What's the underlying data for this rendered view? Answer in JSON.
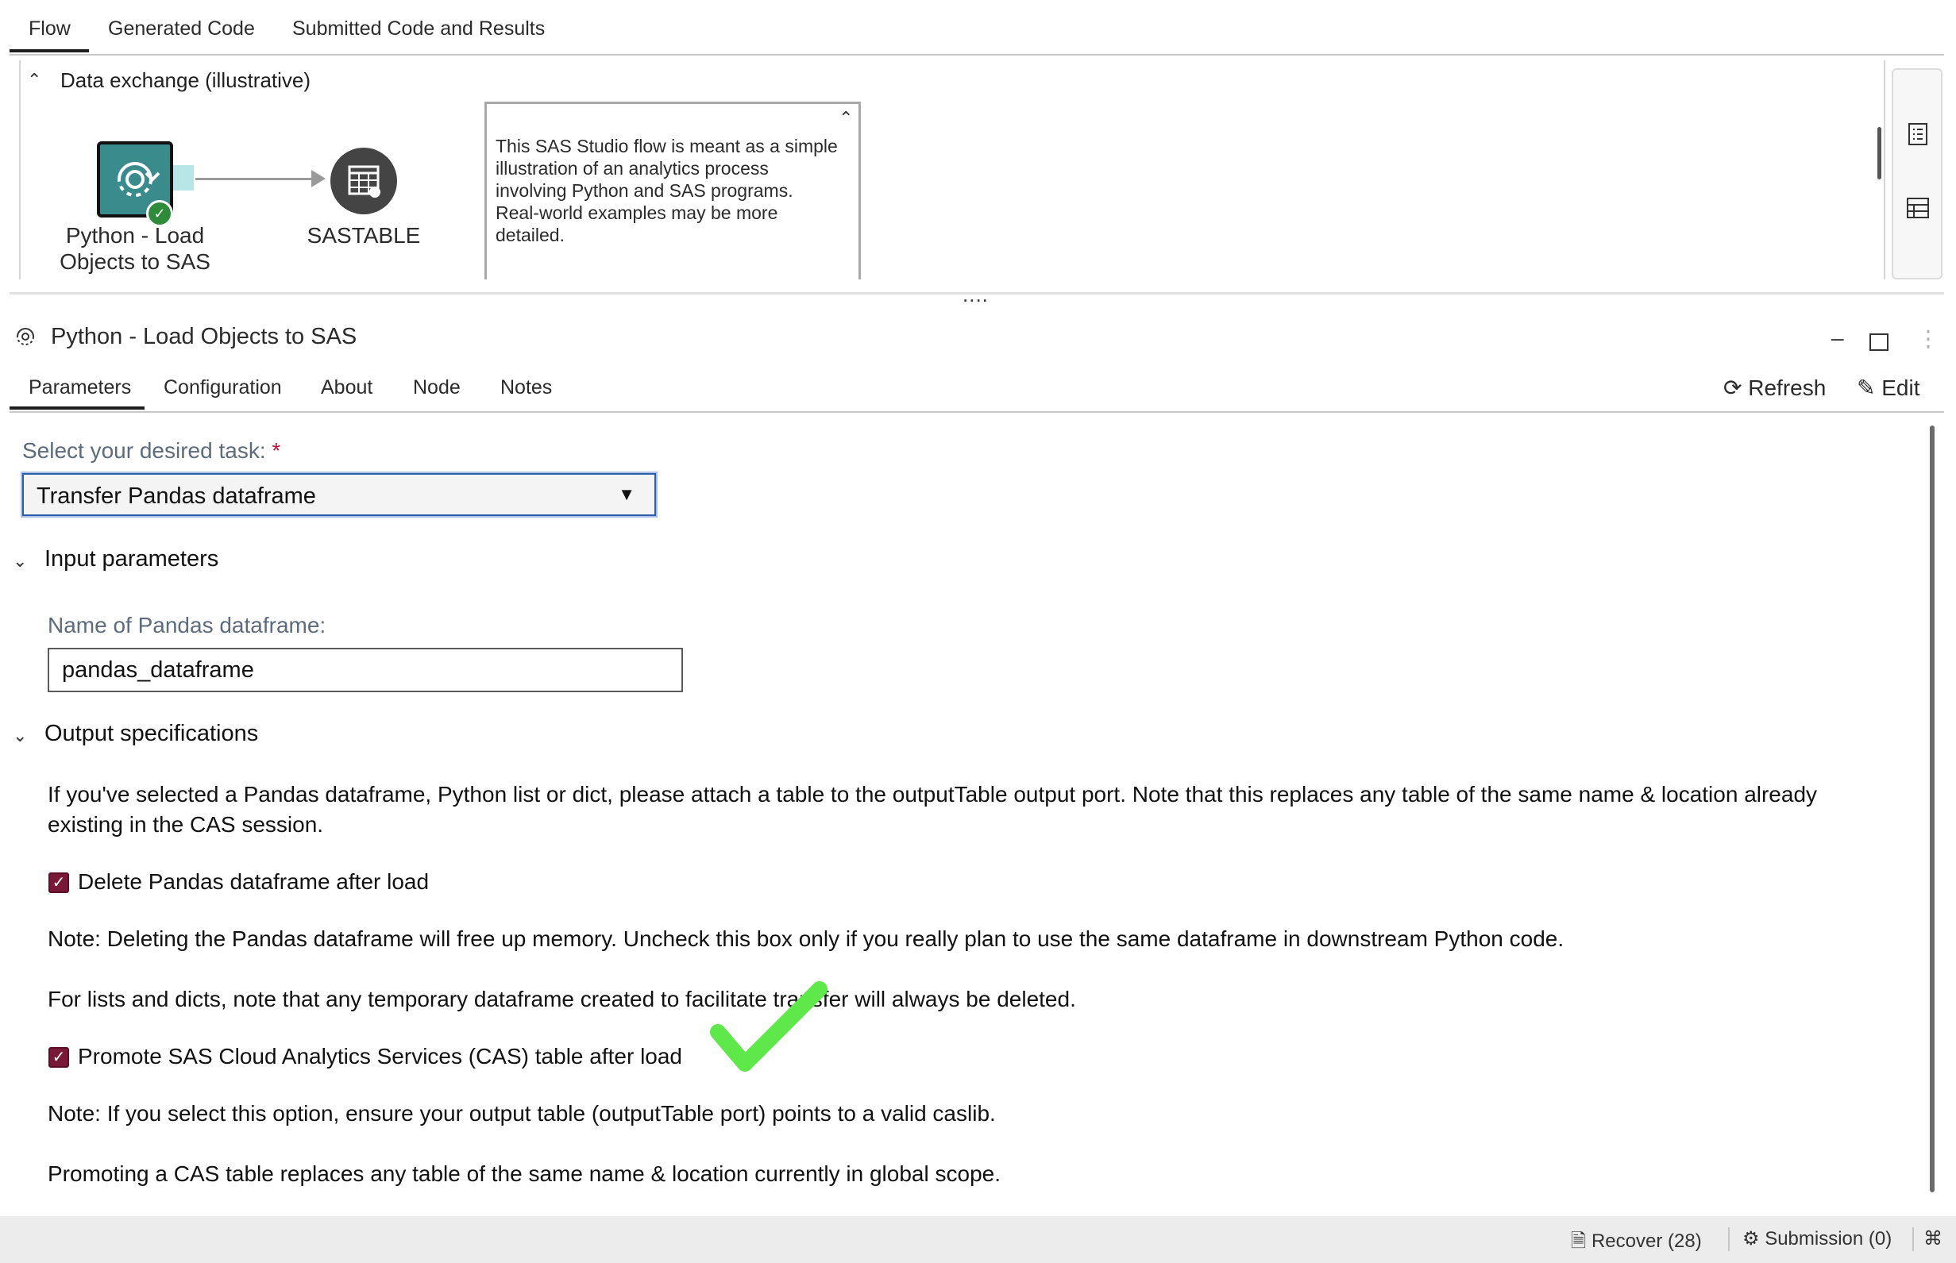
{
  "top_tabs": [
    {
      "label": "Flow",
      "active": true
    },
    {
      "label": "Generated Code",
      "active": false
    },
    {
      "label": "Submitted Code and Results",
      "active": false
    }
  ],
  "flow": {
    "title": "Data exchange (illustrative)",
    "nodes": [
      {
        "label_line1": "Python - Load",
        "label_line2": "Objects to SAS",
        "icon": "python-flow-node-icon",
        "status": "success"
      },
      {
        "label": "SASTABLE",
        "icon": "table-node-icon"
      }
    ],
    "note": {
      "lines": [
        "This SAS Studio flow is meant as a simple",
        "illustration of an analytics process",
        "involving Python and SAS programs.",
        "Real-world examples may be more",
        "detailed."
      ]
    },
    "splitter_handle": "...."
  },
  "node_panel": {
    "title": "Python - Load Objects to SAS",
    "tabs": [
      {
        "label": "Parameters",
        "active": true
      },
      {
        "label": "Configuration",
        "active": false
      },
      {
        "label": "About",
        "active": false
      },
      {
        "label": "Node",
        "active": false
      },
      {
        "label": "Notes",
        "active": false
      }
    ],
    "refresh_label": "Refresh",
    "edit_label": "Edit"
  },
  "form": {
    "task_label": "Select your desired task:",
    "required_mark": "*",
    "task_value": "Transfer Pandas dataframe",
    "input_section": "Input parameters",
    "df_name_label": "Name of Pandas dataframe:",
    "df_name_value": "pandas_dataframe",
    "output_section": "Output specifications",
    "output_desc_line1": "If you've selected a Pandas dataframe, Python list or dict, please attach a table to the outputTable output port.  Note that this replaces any table of the same name & location already",
    "output_desc_line2": "existing in the CAS session.",
    "delete_checkbox_label": "Delete Pandas dataframe after load",
    "delete_checked": true,
    "delete_note": "Note: Deleting the Pandas dataframe will free up memory.  Uncheck this box only if you really plan to use the same dataframe in downstream Python code.",
    "lists_note": "For lists and dicts, note that any temporary dataframe created to facilitate transfer will always be deleted.",
    "promote_checkbox_label": "Promote SAS Cloud Analytics Services (CAS) table after load",
    "promote_checked": true,
    "promote_note": "Note: If you select this option, ensure your output table (outputTable port) points to a valid caslib.",
    "promote_note2": "Promoting a CAS table replaces any table of the same name & location currently in global scope."
  },
  "status_bar": {
    "recover_label": "Recover (28)",
    "submission_label": "Submission (0)"
  },
  "colors": {
    "checkbox": "#7a1838",
    "node_teal": "#3a8b8b",
    "annotation_check": "#5fe84a",
    "required": "#c0143c"
  }
}
